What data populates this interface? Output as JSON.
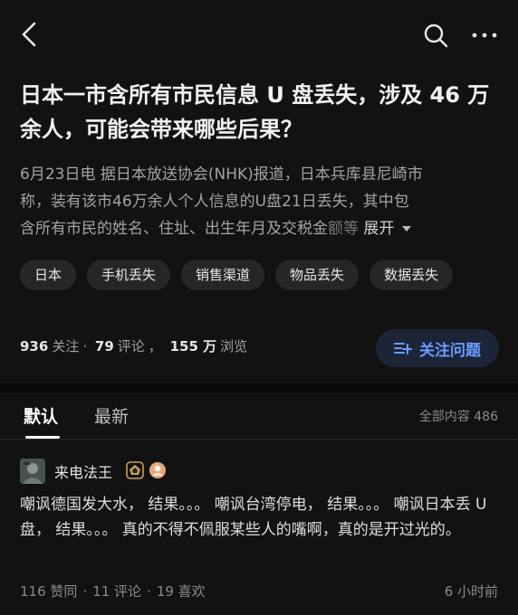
{
  "question": {
    "title": "日本一市含所有市民信息 U 盘丢失，涉及 46 万余人，可能会带来哪些后果？",
    "detail_line1": "6月23日电 据日本放送协会(NHK)报道，日本兵库县尼崎市",
    "detail_line2": "称，装有该市46万余人个人信息的U盘21日丢失，其中包",
    "detail_line3": "含所有市民的姓名、住址、出生年月及交税金",
    "detail_line3_fade": "额等",
    "expand_label": "展开",
    "tags": [
      "日本",
      "手机丢失",
      "销售渠道",
      "物品丢失",
      "数据丢失"
    ],
    "followers_count": "936",
    "followers_label": "关注",
    "comments_count": "79",
    "comments_label": "评论",
    "views_count": "155 万",
    "views_label": "浏览",
    "follow_button_label": "关注问题"
  },
  "answers_tabs": {
    "default_label": "默认",
    "latest_label": "最新",
    "total_label": "全部内容 486"
  },
  "answer": {
    "author": "来电法王",
    "text": "嘲讽德国发大水， 结果。。。 嘲讽台湾停电， 结果。。。 嘲讽日本丢 U 盘， 结果。。。 真的不得不佩服某些人的嘴啊，真的是开过光的。",
    "likes": "116 赞同",
    "comments": "11 评论",
    "favorites": "19 喜欢",
    "time": "6 小时前"
  },
  "colors": {
    "background": "#121212",
    "accent": "#6a9cff",
    "badge_gold": "#c8a25a",
    "badge_peach": "#e8a67c"
  },
  "icons": [
    "back-arrow-icon",
    "search-icon",
    "more-icon",
    "chevron-down-icon",
    "follow-list-icon",
    "level-badge-icon",
    "user-badge-icon"
  ]
}
